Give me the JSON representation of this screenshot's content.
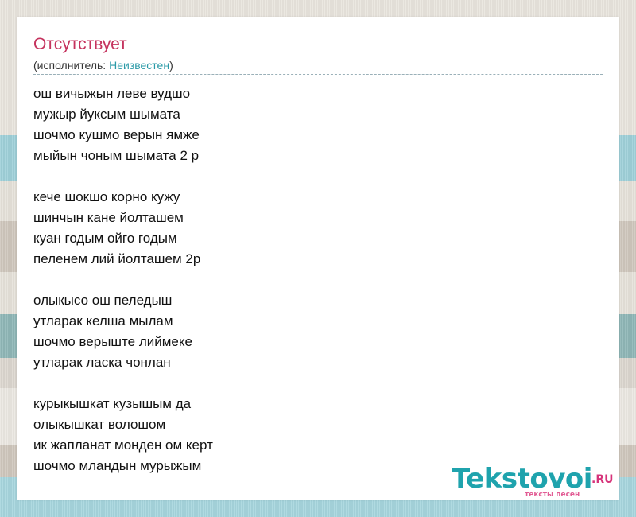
{
  "song": {
    "title": "Отсутствует",
    "artist_prefix": "(исполнитель: ",
    "artist_name": "Неизвестен",
    "artist_suffix": ")"
  },
  "lyrics": [
    "ош вичыжын леве вудшо",
    "мужыр йуксым шымата",
    "шочмо кушмо верын ямже",
    "мыйын чоным шымата 2 р",
    "",
    "кече шокшо корно кужу",
    "шинчын кане йолташем",
    "куан годым ойго годым",
    "пеленем лий йолташем 2р",
    "",
    "олыкысо ош пеледыш",
    "утларак келша мылам",
    "шочмо верыште лиймеке",
    "утларак ласка чонлан",
    "",
    "курыкышкат кузышым да",
    "олыкышкат волошом",
    "ик жапланат монден ом керт",
    "шочмо мландын мурыжым"
  ],
  "logo": {
    "main": "Tekstovoi",
    "tld": ".RU",
    "tagline": "тексты песен"
  },
  "colors": {
    "title": "#c5335e",
    "artist_link": "#2a9aa7",
    "logo_main": "#1fa3ad",
    "logo_accent": "#d6337a"
  }
}
